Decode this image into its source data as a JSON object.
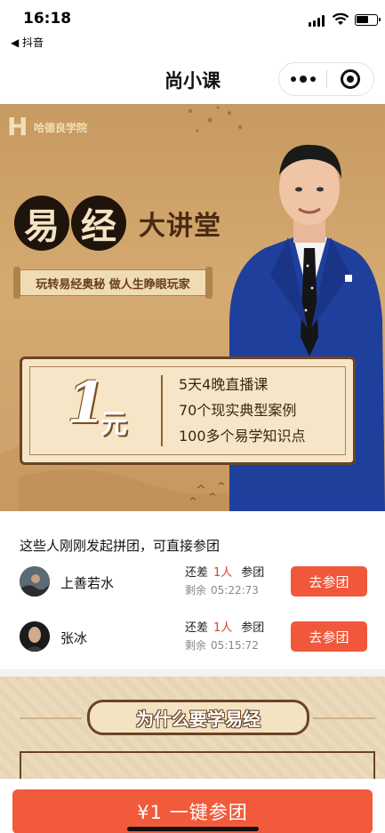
{
  "status_bar": {
    "time": "16:18",
    "back_app": "◀ 抖音"
  },
  "nav": {
    "title": "尚小课"
  },
  "banner": {
    "logo_text": "哈德良学院",
    "title_chars": [
      "易",
      "经"
    ],
    "title_suffix": "大讲堂",
    "slogan": "玩转易经奥秘 做人生睁眼玩家",
    "price_number": "1",
    "price_unit": "元",
    "selling_points": [
      "5天4晚直播课",
      "70个现实典型案例",
      "100多个易学知识点"
    ]
  },
  "groups": {
    "heading": "这些人刚刚发起拼团，可直接参团",
    "items": [
      {
        "name": "上善若水",
        "need_prefix": "还差",
        "need_count": "1人",
        "need_suffix": "参团",
        "remain_label": "剩余",
        "remain_time": "05:22:73",
        "button": "去参团"
      },
      {
        "name": "张冰",
        "need_prefix": "还差",
        "need_count": "1人",
        "need_suffix": "参团",
        "remain_label": "剩余",
        "remain_time": "05:15:72",
        "button": "去参团"
      }
    ]
  },
  "why": {
    "title": "为什么要学易经"
  },
  "bottom": {
    "buy_button": "¥1 一键参团"
  }
}
